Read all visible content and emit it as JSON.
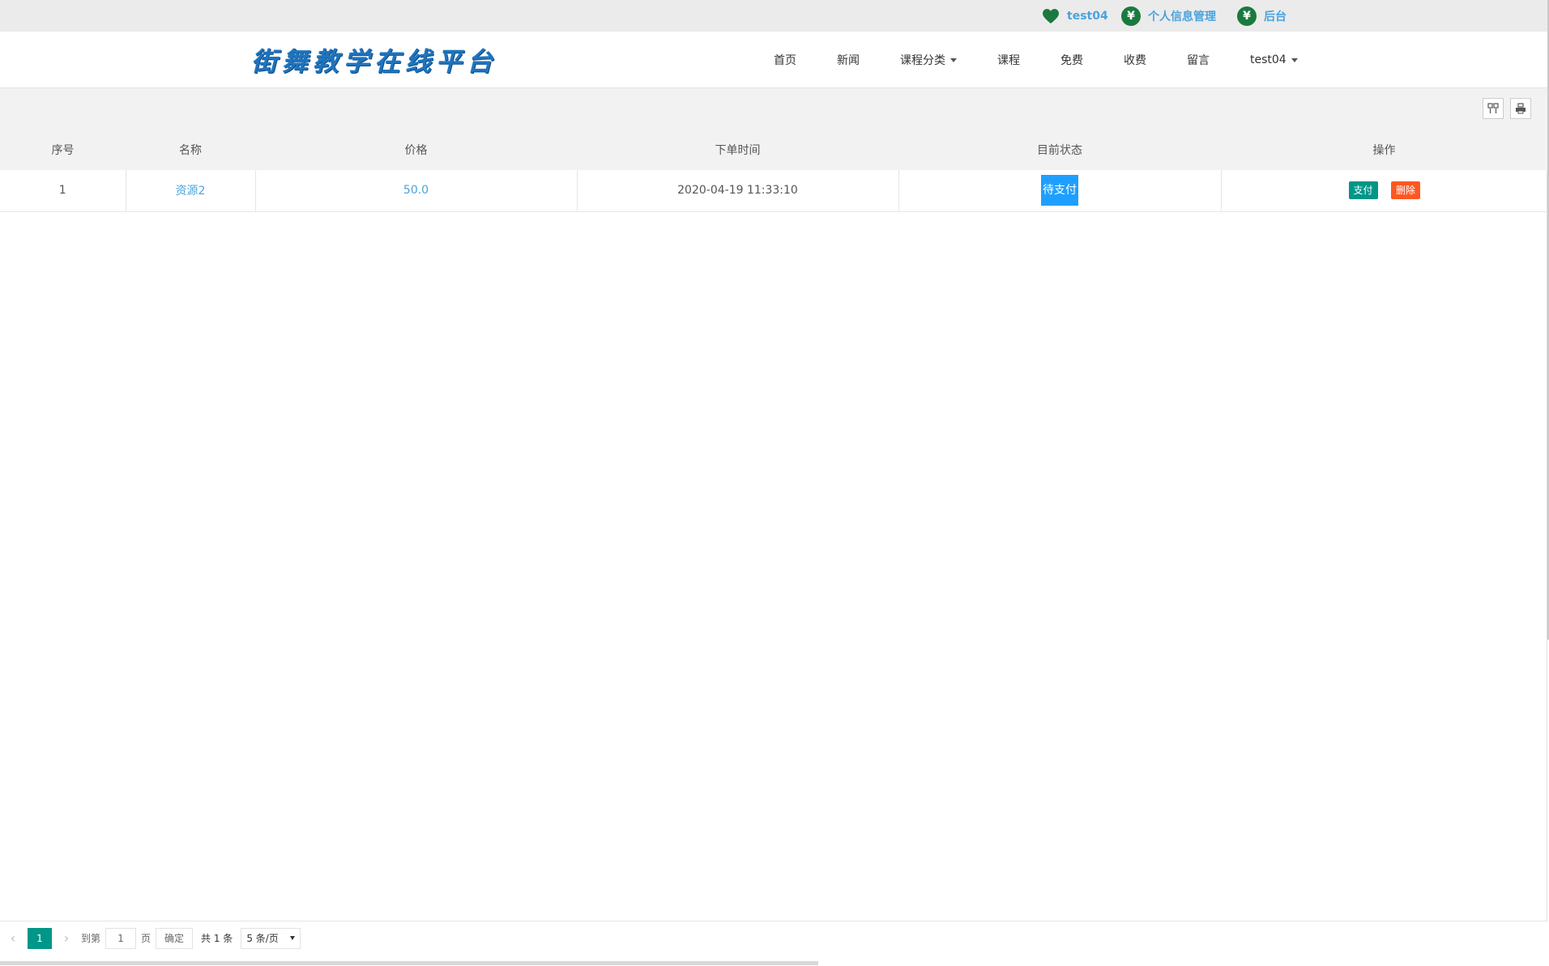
{
  "topbar": {
    "user_label": "test04",
    "profile_label": "个人信息管理",
    "admin_label": "后台",
    "coin_symbol": "¥"
  },
  "header": {
    "logo_text": "街舞教学在线平台",
    "nav": {
      "home": "首页",
      "news": "新闻",
      "category": "课程分类",
      "courses": "课程",
      "free": "免费",
      "paid": "收费",
      "message": "留言",
      "user": "test04"
    }
  },
  "table": {
    "headers": [
      "序号",
      "名称",
      "价格",
      "下单时间",
      "目前状态",
      "操作"
    ],
    "rows": [
      {
        "index": "1",
        "name": "资源2",
        "price": "50.0",
        "order_time": "2020-04-19 11:33:10",
        "status": "待支付",
        "pay_label": "支付",
        "delete_label": "删除"
      }
    ]
  },
  "pager": {
    "prev": "‹",
    "current": "1",
    "next": "›",
    "goto_label": "到第",
    "goto_value": "1",
    "page_unit": "页",
    "confirm_label": "确定",
    "total_label": "共 1 条",
    "limit_label": "5 条/页"
  },
  "colors": {
    "accent": "#009688",
    "link": "#4aa3df",
    "status": "#1e9fff",
    "danger": "#ff5722"
  }
}
